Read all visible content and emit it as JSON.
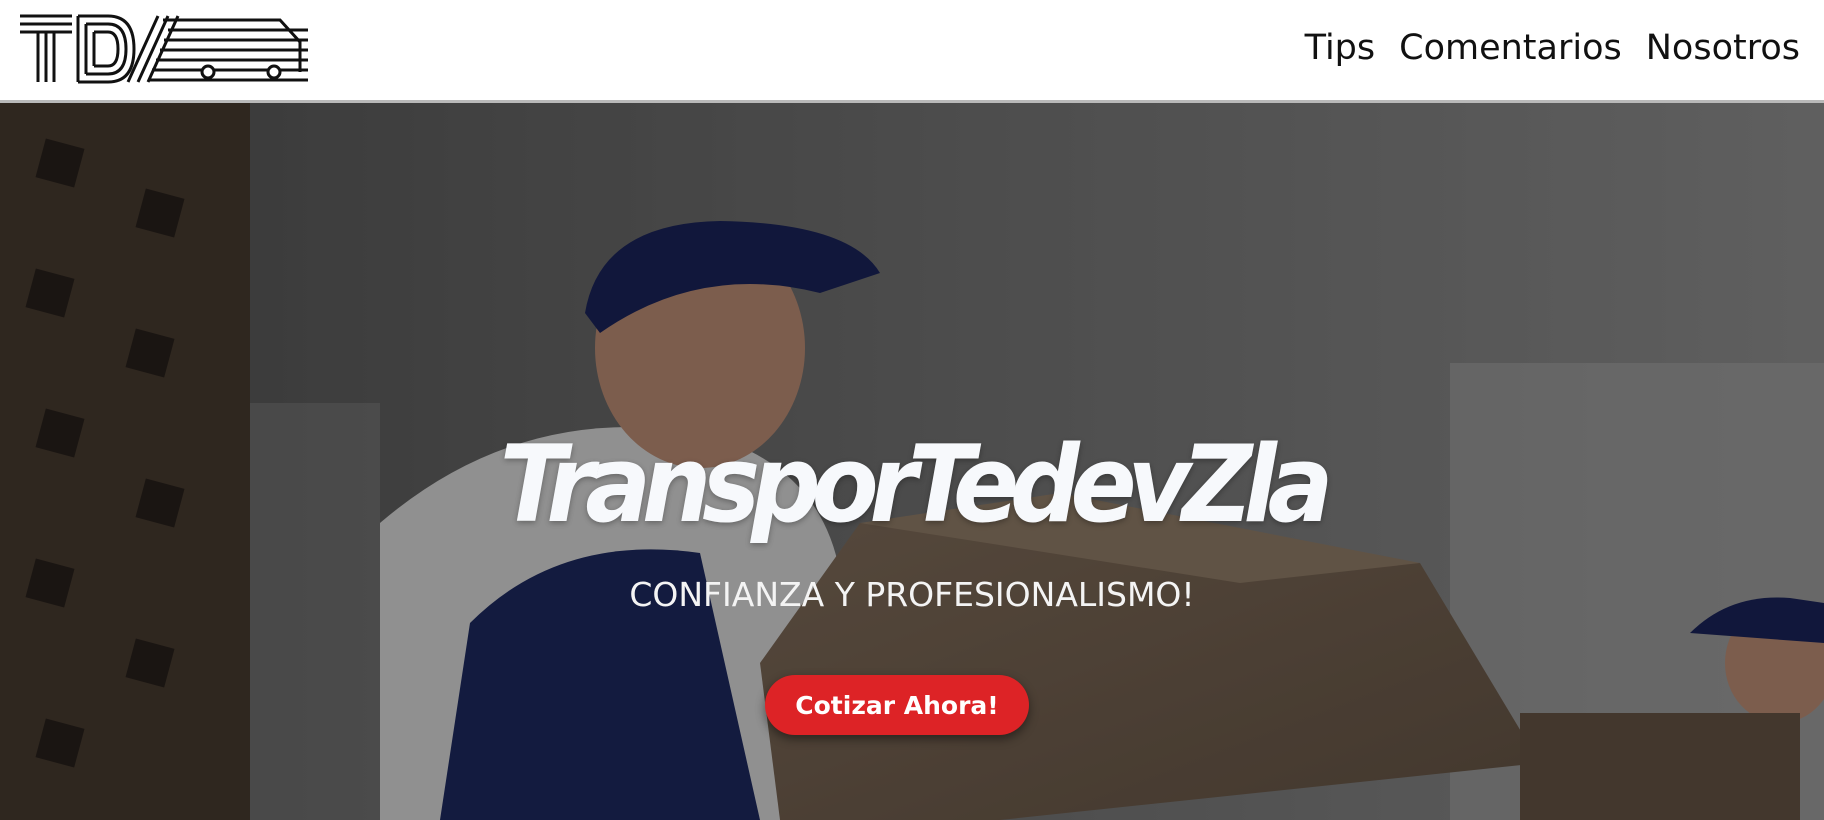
{
  "header": {
    "logo_text": "TDV",
    "nav": [
      {
        "label": "Tips"
      },
      {
        "label": "Comentarios"
      },
      {
        "label": "Nosotros"
      }
    ]
  },
  "hero": {
    "title": "TransporTedevZla",
    "subtitle": "CONFIANZA Y PROFESIONALISMO!",
    "cta_label": "Cotizar Ahora!"
  },
  "colors": {
    "accent": "#dd2326",
    "header_bg": "#ffffff",
    "hero_text": "#f7f9fc"
  }
}
